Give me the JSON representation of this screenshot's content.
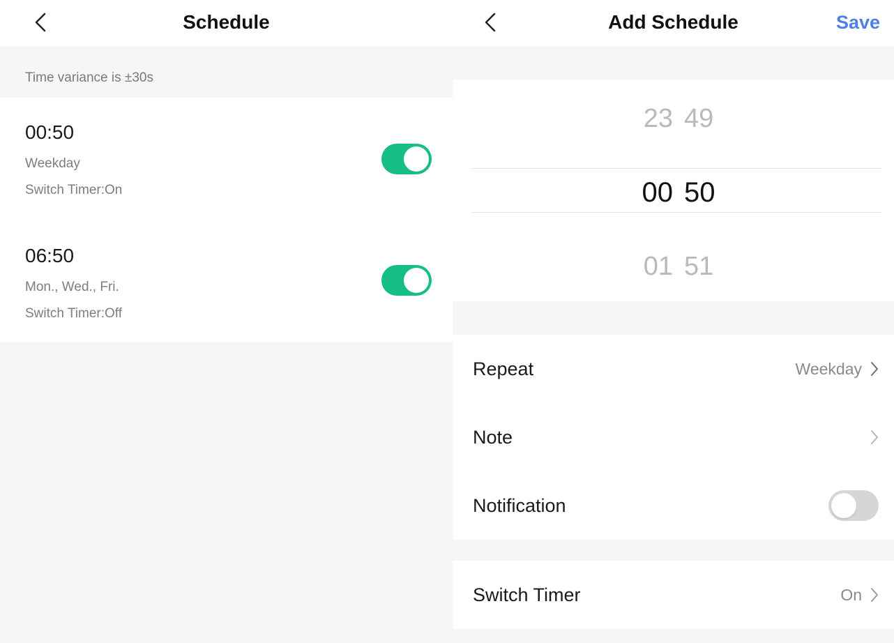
{
  "schedule_screen": {
    "title": "Schedule",
    "hint": "Time variance is ±30s",
    "items": [
      {
        "time": "00:50",
        "repeat": "Weekday",
        "switch_timer": "Switch Timer:On",
        "enabled": true
      },
      {
        "time": "06:50",
        "repeat": "Mon., Wed., Fri.",
        "switch_timer": "Switch Timer:Off",
        "enabled": true
      }
    ]
  },
  "add_schedule_screen": {
    "title": "Add Schedule",
    "save_label": "Save",
    "picker": {
      "previous": {
        "hour": "23",
        "minute": "49"
      },
      "selected": {
        "hour": "00",
        "minute": "50"
      },
      "next": {
        "hour": "01",
        "minute": "51"
      }
    },
    "rows": {
      "repeat": {
        "label": "Repeat",
        "value": "Weekday"
      },
      "note": {
        "label": "Note",
        "value": ""
      },
      "notification": {
        "label": "Notification",
        "enabled": false
      },
      "switch_timer": {
        "label": "Switch Timer",
        "value": "On"
      }
    }
  },
  "colors": {
    "toggle_on": "#15bd87",
    "toggle_off": "#d6d6d6",
    "save_accent": "#4d7fe6",
    "background": "#f6f6f6"
  },
  "icons": [
    "chevron-left-icon",
    "chevron-right-icon"
  ]
}
